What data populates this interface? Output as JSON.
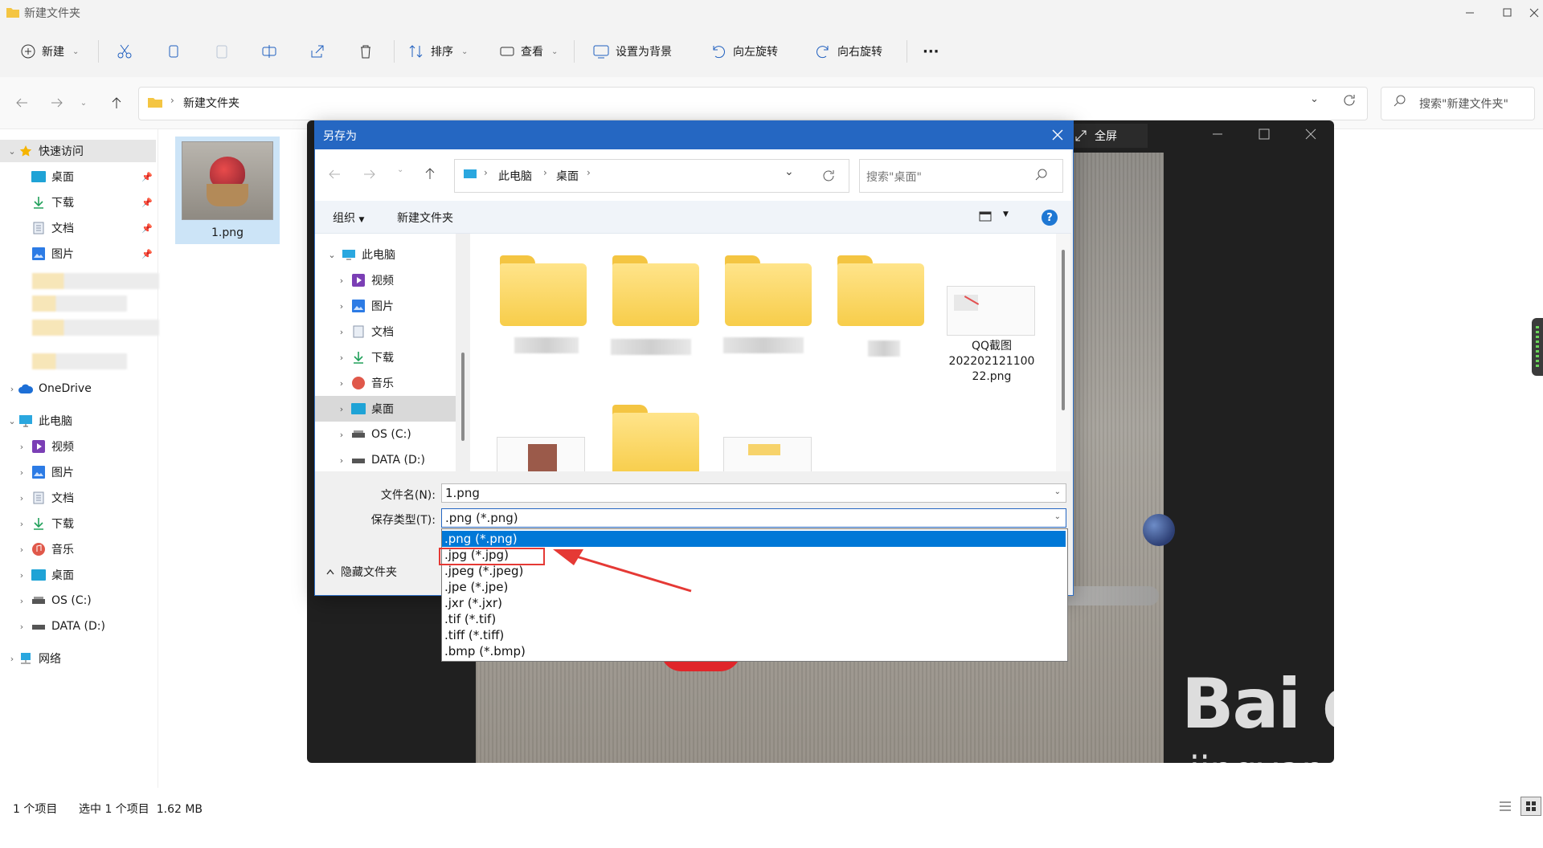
{
  "explorer": {
    "window_title": "新建文件夹",
    "toolbar": {
      "new": "新建",
      "sort": "排序",
      "view": "查看",
      "set_background": "设置为背景",
      "rotate_left": "向左旋转",
      "rotate_right": "向右旋转",
      "more": "···"
    },
    "breadcrumb": "新建文件夹",
    "search_placeholder": "搜索\"新建文件夹\"",
    "sidebar": {
      "quick_access": "快速访问",
      "quick_items": [
        "桌面",
        "下载",
        "文档",
        "图片"
      ],
      "onedrive": "OneDrive",
      "this_pc": "此电脑",
      "pc_items": [
        "视频",
        "图片",
        "文档",
        "下载",
        "音乐",
        "桌面",
        "OS (C:)",
        "DATA (D:)"
      ],
      "network": "网络"
    },
    "file": {
      "name": "1.png"
    },
    "status": {
      "count": "1 个项目",
      "selected": "选中 1 个项目  1.62 MB"
    }
  },
  "viewer": {
    "fullscreen": "全屏"
  },
  "dialog": {
    "title": "另存为",
    "path": [
      "此电脑",
      "桌面"
    ],
    "search_placeholder": "搜索\"桌面\"",
    "organize": "组织",
    "new_folder": "新建文件夹",
    "tree": [
      "此电脑",
      "视频",
      "图片",
      "文档",
      "下载",
      "音乐",
      "桌面",
      "OS (C:)",
      "DATA (D:)"
    ],
    "qq_file": [
      "QQ截图",
      "202202121100",
      "22.png"
    ],
    "filename_label": "文件名(N):",
    "filename_value": "1.png",
    "type_label": "保存类型(T):",
    "type_value": ".png (*.png)",
    "hide_folders": "隐藏文件夹",
    "type_options": [
      ".png (*.png)",
      ".jpg (*.jpg)",
      ".jpeg (*.jpeg)",
      ".jpe (*.jpe)",
      ".jxr (*.jxr)",
      ".tif (*.tif)",
      ".tiff (*.tiff)",
      ".bmp (*.bmp)"
    ]
  },
  "watermark": {
    "logo": "Bai du 经验",
    "url": "jingyan.baidu.com"
  },
  "colors": {
    "dialog_title": "#2567c2",
    "selection": "#0078d7",
    "annotation": "#e53935"
  }
}
